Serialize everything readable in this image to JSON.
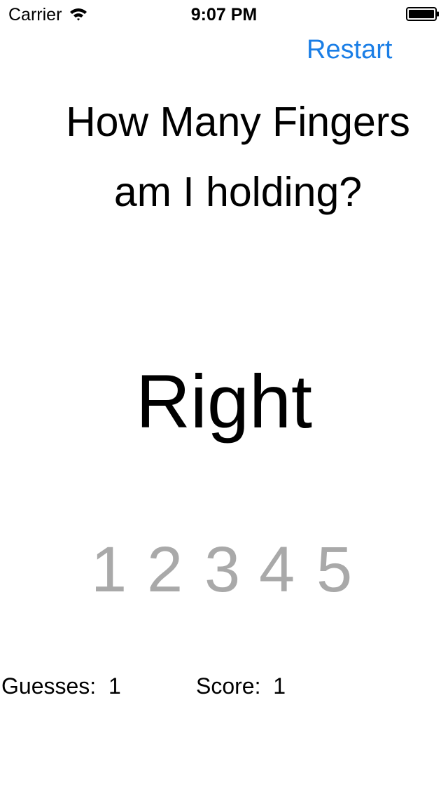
{
  "status_bar": {
    "carrier": "Carrier",
    "time": "9:07 PM",
    "signal_icon": "wifi-icon",
    "battery_icon": "battery-icon"
  },
  "nav": {
    "restart_label": "Restart"
  },
  "question": {
    "line1": "How Many Fingers",
    "line2": "am I holding?"
  },
  "result": "Right",
  "choices": [
    "1",
    "2",
    "3",
    "4",
    "5"
  ],
  "stats": {
    "guesses_label": "Guesses:",
    "guesses_value": "1",
    "score_label": "Score:",
    "score_value": "1"
  },
  "colors": {
    "accent": "#1a7ee6",
    "choice": "#a9a9a9",
    "text": "#000000",
    "background": "#ffffff"
  }
}
